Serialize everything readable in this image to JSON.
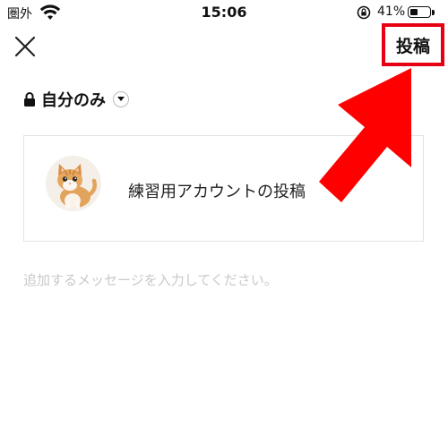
{
  "status_bar": {
    "carrier": "圏外",
    "time": "15:06",
    "battery_text": "41%",
    "battery_level": 0.41
  },
  "header": {
    "close_icon": "close-icon",
    "post_label": "投稿",
    "highlight_color": "#e60012"
  },
  "privacy": {
    "label": "自分のみ",
    "icon": "lock-icon"
  },
  "shared_card": {
    "avatar": "kitten-photo",
    "title": "練習用アカウントの投稿"
  },
  "message": {
    "placeholder": "追加するメッセージを入力してください。",
    "value": ""
  },
  "annotation": {
    "arrow_color": "#ff0000"
  }
}
